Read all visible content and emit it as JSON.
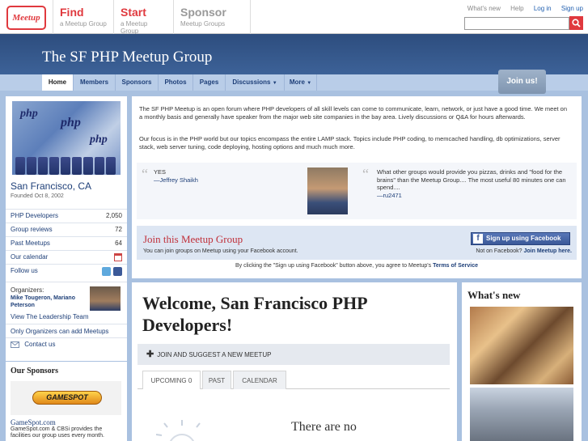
{
  "topbar": {
    "logo": "Meetup",
    "nav": [
      {
        "title": "Find",
        "sub": "a Meetup Group"
      },
      {
        "title": "Start",
        "sub": "a Meetup Group"
      },
      {
        "title": "Sponsor",
        "sub": "Meetup Groups"
      }
    ],
    "links": {
      "whats_new": "What's new",
      "help": "Help",
      "login": "Log in",
      "signup": "Sign up"
    },
    "search_value": ""
  },
  "group": {
    "title": "The SF PHP Meetup Group"
  },
  "tabs": [
    "Home",
    "Members",
    "Sponsors",
    "Photos",
    "Pages",
    "Discussions",
    "More"
  ],
  "join_tab": "Join us!",
  "sidebar": {
    "city": "San Francisco, CA",
    "founded": "Founded Oct 8, 2002",
    "stats": [
      {
        "label": "PHP Developers",
        "value": "2,050"
      },
      {
        "label": "Group reviews",
        "value": "72"
      },
      {
        "label": "Past Meetups",
        "value": "64"
      },
      {
        "label": "Our calendar",
        "value": ""
      }
    ],
    "follow": "Follow us",
    "organizers_label": "Organizers:",
    "organizers": "Mike Tougeron, Mariano Peterson",
    "leadership": "View The Leadership Team",
    "add_meetups": "Only Organizers can add Meetups",
    "contact": "Contact us"
  },
  "sponsors": {
    "heading": "Our Sponsors",
    "logo_text": "GAMESPOT",
    "name": "GameSpot.com",
    "desc": "GameSpot.com & CBSi provides the facilities our group uses every month."
  },
  "description": {
    "p1": "The SF PHP Meetup is an open forum where PHP developers of all skill levels can come to communicate, learn, network, or just have a good time. We meet on a monthly basis and generally have speaker from the major web site companies in the bay area. Lively discussions or Q&A for hours afterwards.",
    "p2": "Our focus is in the PHP world but our topics encompass the entire LAMP stack. Topics include PHP coding, to memcached handling, db optimizations, server stack, web server tuning, code deploying, hosting options and much much more."
  },
  "testimonials": [
    {
      "quote": "YES",
      "author": "—Jeffrey Shaikh"
    },
    {
      "quote": "What other groups would provide you pizzas, drinks and \"food for the brains\" than the Meetup Group.... The most useful 80 minutes one can spend....",
      "author": "—ru2471"
    }
  ],
  "join": {
    "title": "Join this Meetup Group",
    "sub": "You can join groups on Meetup using your Facebook account.",
    "fb_button": "Sign up using Facebook",
    "not_fb": "Not on Facebook?",
    "not_fb_link": "Join Meetup here.",
    "agree_prefix": "By clicking the \"Sign up using Facebook\" button above, you agree to Meetup's",
    "terms": "Terms of Service"
  },
  "welcome": {
    "title": "Welcome, San Francisco PHP Developers!",
    "suggest": "JOIN AND SUGGEST A NEW MEETUP",
    "event_tabs": [
      "UPCOMING 0",
      "PAST",
      "CALENDAR"
    ],
    "no_meetups": "There are no"
  },
  "whats_new": {
    "heading": "What's new"
  }
}
